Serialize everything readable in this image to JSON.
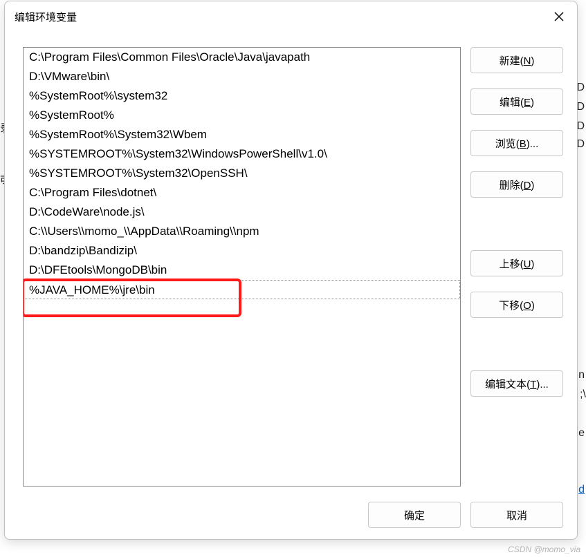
{
  "dialog": {
    "title": "编辑环境变量",
    "close_aria": "关闭"
  },
  "list": {
    "items": [
      "C:\\Program Files\\Common Files\\Oracle\\Java\\javapath",
      "D:\\VMware\\bin\\",
      "%SystemRoot%\\system32",
      "%SystemRoot%",
      "%SystemRoot%\\System32\\Wbem",
      "%SYSTEMROOT%\\System32\\WindowsPowerShell\\v1.0\\",
      "%SYSTEMROOT%\\System32\\OpenSSH\\",
      "C:\\Program Files\\dotnet\\",
      "D:\\CodeWare\\node.js\\",
      "C:\\\\Users\\\\momo_\\\\AppData\\\\Roaming\\\\npm",
      "D:\\bandzip\\Bandizip\\",
      "D:\\DFEtools\\MongoDB\\bin",
      "%JAVA_HOME%\\jre\\bin"
    ],
    "editing_index": 12
  },
  "buttons": {
    "new": {
      "text": "新建(",
      "hotkey": "N",
      "suffix": ")"
    },
    "edit": {
      "text": "编辑(",
      "hotkey": "E",
      "suffix": ")"
    },
    "browse": {
      "text": "浏览(",
      "hotkey": "B",
      "suffix": ")..."
    },
    "delete": {
      "text": "删除(",
      "hotkey": "D",
      "suffix": ")"
    },
    "moveup": {
      "text": "上移(",
      "hotkey": "U",
      "suffix": ")"
    },
    "movedown": {
      "text": "下移(",
      "hotkey": "O",
      "suffix": ")"
    },
    "edittext": {
      "text": "编辑文本(",
      "hotkey": "T",
      "suffix": ")..."
    },
    "ok": "确定",
    "cancel": "取消"
  },
  "backdrop": {
    "fragments": [
      "录",
      "戓",
      "D",
      "D",
      "D",
      "D",
      "n",
      ";\\",
      "e",
      "d"
    ]
  },
  "watermark": "CSDN @momo_via"
}
